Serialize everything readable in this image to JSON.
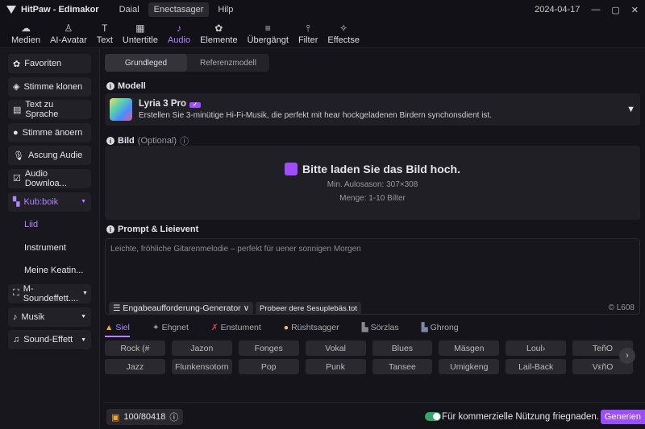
{
  "app": {
    "title": "HitPaw - Edimakor",
    "menus": [
      "Daial",
      "Enectasager",
      "Hilp"
    ],
    "date": "2024-04-17"
  },
  "toolbar": [
    {
      "label": "Medien",
      "icon": "media-icon"
    },
    {
      "label": "AI-Avatar",
      "icon": "avatar-icon"
    },
    {
      "label": "Text",
      "icon": "text-icon"
    },
    {
      "label": "Untertitle",
      "icon": "subtitle-icon"
    },
    {
      "label": "Audio",
      "icon": "audio-icon",
      "active": true
    },
    {
      "label": "Elemente",
      "icon": "elements-icon"
    },
    {
      "label": "Übergängt",
      "icon": "transition-icon"
    },
    {
      "label": "Filter",
      "icon": "filter-icon"
    },
    {
      "label": "Effectse",
      "icon": "effects-icon"
    }
  ],
  "sidebar": [
    {
      "label": "Favoriten",
      "icon": "✿"
    },
    {
      "label": "Stimme klonen",
      "icon": "◈"
    },
    {
      "label": "Text zu Sprache",
      "icon": "▤"
    },
    {
      "label": "Stimme änoern",
      "icon": "●"
    },
    {
      "label": "Ascung Audie",
      "icon": "🎙"
    },
    {
      "label": "Audio Downloa...",
      "icon": "☑"
    },
    {
      "label": "Kub:boik",
      "icon": "▚",
      "purple": true,
      "caret": true
    },
    {
      "label": "Liid",
      "sub": true,
      "purple": true
    },
    {
      "label": "Instrument",
      "sub": true
    },
    {
      "label": "Meine Keatin...",
      "sub": true
    },
    {
      "label": "M-Soundeffett....",
      "icon": "⛶",
      "caret": true
    },
    {
      "label": "Musik",
      "icon": "♪",
      "caret": true
    },
    {
      "label": "Sound-Effett",
      "icon": "♫",
      "caret": true
    }
  ],
  "tabs": [
    "Grundleged",
    "Referenzmodell"
  ],
  "model": {
    "label": "Modell",
    "name": "Lyria 3 Pro",
    "badge": "✓",
    "desc": "Erstellen Sie 3-minütige Hi-Fi-Musik, die perfekt mit hear hockgeladenen Birdern synchonsdient ist."
  },
  "image": {
    "label": "Bild",
    "optional": "(Optional)",
    "title": "Bitte laden Sie das Bild hoch.",
    "res": "Min. Aulosason: 307×308",
    "count": "Menge: 1-10 Bilter"
  },
  "prompt": {
    "label": "Prompt & Lieievent",
    "placeholder": "Leichte, fröhliche Gitarenmelodie – perfekt für uener sonnigen Morgen",
    "generator": "☰ Engabeaufforderung-Generator ∨",
    "sample": "Probeer dere Sesuplebäs.tot",
    "count": "© L608"
  },
  "genre_tabs": [
    "Siel",
    "Ehgnet",
    "Enstument",
    "Rüshtsagger",
    "Sörzlas",
    "Ghrong"
  ],
  "chips": [
    "Rock (#",
    "Jazon",
    "Fonges",
    "Vokal",
    "Blues",
    "Mäsgen",
    "Loul›",
    "TeñO",
    "Jazz",
    "Flunkensotorn",
    "Pop",
    "Punk",
    "Tansee",
    "Umigkeng",
    "Lail-Back",
    "VεñO"
  ],
  "footer": {
    "credits": "100/80418",
    "commercial": "Für kommerzielle Nützung friegnaden.",
    "generate": "Generien",
    "toggle_on": true
  },
  "colors": {
    "accent": "#a04cff",
    "toggle": "#35a36a"
  }
}
